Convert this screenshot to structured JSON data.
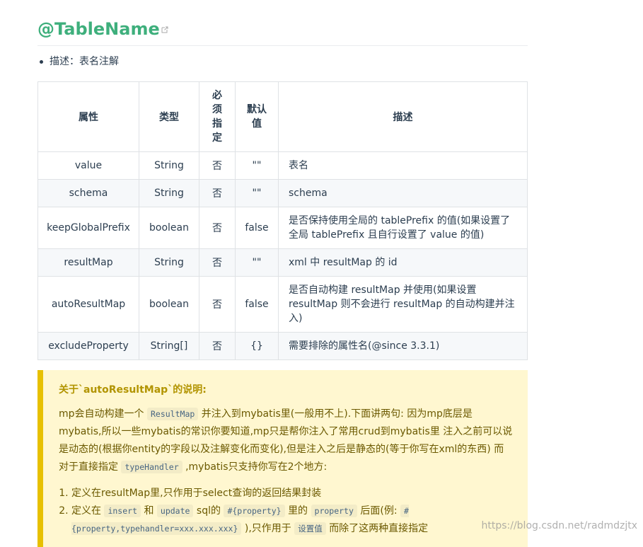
{
  "heading": "@TableName",
  "intro": "描述：表名注解",
  "table": {
    "headers": [
      "属性",
      "类型",
      "必须指定",
      "默认值",
      "描述"
    ],
    "header_vertical": {
      "required": [
        "必",
        "须",
        "指",
        "定"
      ],
      "default": [
        "默认",
        "值"
      ]
    },
    "rows": [
      {
        "attr": "value",
        "type": "String",
        "required": "否",
        "default": "\"\"",
        "desc": "表名"
      },
      {
        "attr": "schema",
        "type": "String",
        "required": "否",
        "default": "\"\"",
        "desc": "schema"
      },
      {
        "attr": "keepGlobalPrefix",
        "type": "boolean",
        "required": "否",
        "default": "false",
        "desc": "是否保持使用全局的 tablePrefix 的值(如果设置了全局 tablePrefix 且自行设置了 value 的值)"
      },
      {
        "attr": "resultMap",
        "type": "String",
        "required": "否",
        "default": "\"\"",
        "desc": "xml 中 resultMap 的 id"
      },
      {
        "attr": "autoResultMap",
        "type": "boolean",
        "required": "否",
        "default": "false",
        "desc": "是否自动构建 resultMap 并使用(如果设置 resultMap 则不会进行 resultMap 的自动构建并注入)"
      },
      {
        "attr": "excludeProperty",
        "type": "String[]",
        "required": "否",
        "default": "{}",
        "desc": "需要排除的属性名(@since 3.3.1)"
      }
    ]
  },
  "tip": {
    "title": "关于`autoResultMap`的说明:",
    "p1": {
      "a": "mp会自动构建一个",
      "code1": "ResultMap",
      "b": "并注入到mybatis里(一般用不上).下面讲两句: 因为mp底层是mybatis,所以一些mybatis的常识你要知道,mp只是帮你注入了常用crud到mybatis里 注入之前可以说是动态的(根据你entity的字段以及注解变化而变化),但是注入之后是静态的(等于你写在xml的东西) 而对于直接指定",
      "code2": "typeHandler",
      "c": ",mybatis只支持你写在2个地方:"
    },
    "list": {
      "item1": "定义在resultMap里,只作用于select查询的返回结果封装",
      "item2": {
        "a": "定义在",
        "code1": "insert",
        "b": "和",
        "code2": "update",
        "c": "sql的",
        "code3": "#{property}",
        "d": "里的",
        "code4": "property",
        "e": "后面(例:",
        "code5": "#{property,typehandler=xxx.xxx.xxx}",
        "f": "),只作用于",
        "code6": "设置值",
        "g": "而除了这两种直接指定"
      }
    }
  },
  "watermark": "https://blog.csdn.net/radmdzjtx"
}
